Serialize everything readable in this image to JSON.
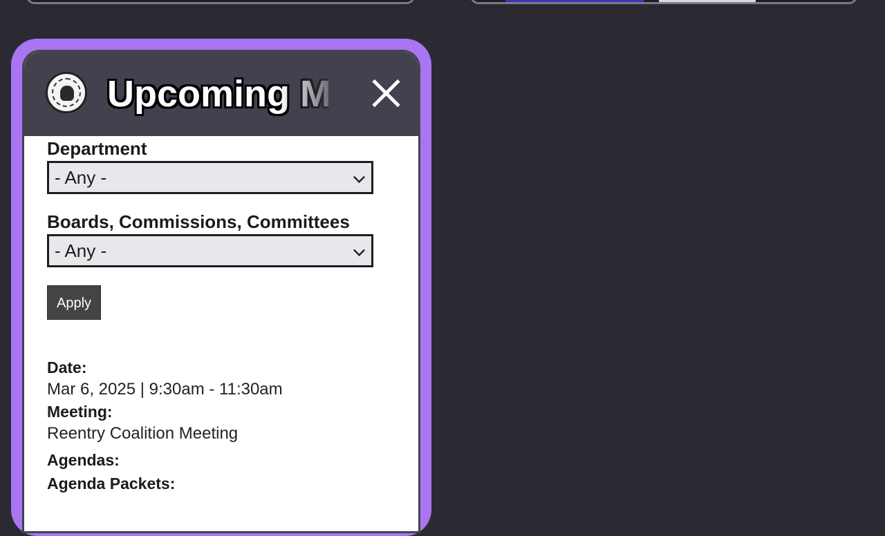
{
  "widget": {
    "title": "Upcoming Meetings",
    "close_icon": "close-icon",
    "logo_icon": "city-seal-icon"
  },
  "filters": {
    "department_label": "Department",
    "department_value": "- Any -",
    "boards_label": "Boards, Commissions, Committees",
    "boards_value": "- Any -",
    "apply_label": "Apply"
  },
  "meeting": {
    "date_label": "Date:",
    "date_value": "Mar 6, 2025 | 9:30am - 11:30am",
    "meeting_label": "Meeting:",
    "meeting_value": "Reentry Coalition Meeting",
    "agendas_label": "Agendas:",
    "agenda_packets_label": "Agenda Packets:"
  },
  "colors": {
    "page_background": "#2b2a33",
    "widget_border": "#a876f2",
    "header_background": "#42414d",
    "apply_button": "#444444"
  }
}
